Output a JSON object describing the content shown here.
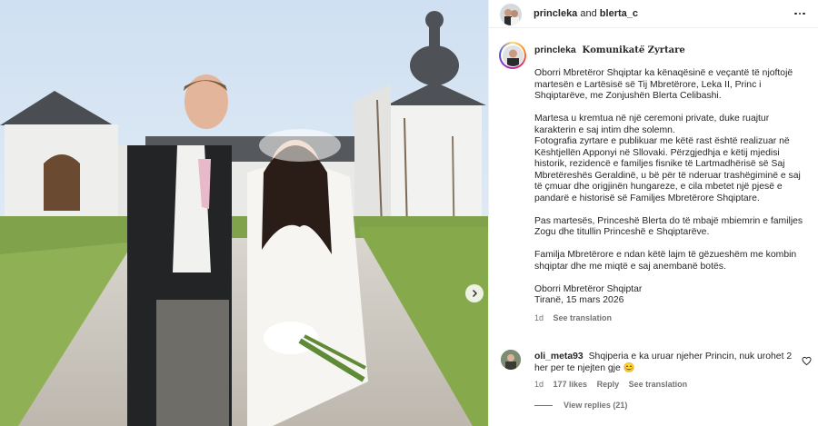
{
  "header": {
    "user1": "princleka",
    "connector": "and",
    "user2": "blerta_c"
  },
  "post": {
    "username": "princleka",
    "title": "𝐊𝐨𝐦𝐮𝐧𝐢𝐤𝐚𝐭𝐞̈ 𝐙𝐲𝐫𝐭𝐚𝐫𝐞",
    "p1": "Oborri Mbretëror Shqiptar ka kënaqësinë e veçantë të njoftojë martesën e Lartësisë së Tij Mbretërore, Leka II, Princ i Shqiptarëve, me Zonjushën Blerta Celibashi.",
    "p2": "Martesa u kremtua në një ceremoni private, duke ruajtur karakterin e saj intim dhe solemn.",
    "p3": "Fotografia zyrtare e publikuar me këtë rast është realizuar në Kështjellën Apponyi në Sllovaki. Përzgjedhja e këtij mjedisi historik, rezidencë e familjes fisnike të Lartmadhërisë së Saj Mbretëreshës Geraldinë, u bë për të nderuar trashëgiminë e saj të çmuar dhe origjinën hungareze, e cila mbetet një pjesë e pandarë e historisë së Familjes Mbretërore Shqiptare.",
    "p4": "Pas martesës, Princeshë Blerta do të mbajë mbiemrin e familjes Zogu dhe titullin Princeshë e Shqiptarëve.",
    "p5": "Familja Mbretërore e ndan këtë lajm të gëzueshëm me kombin shqiptar dhe me miqtë e saj anembanë botës.",
    "sign1": "Oborri Mbretëror Shqiptar",
    "sign2": "Tiranë, 15 mars 2026",
    "time": "1d",
    "see_translation": "See translation"
  },
  "comment": {
    "username": "oli_meta93",
    "text": "Shqiperia e ka uruar njeher Princin, nuk urohet 2 her per te njejten gje 😊",
    "time": "1d",
    "likes": "177 likes",
    "reply": "Reply",
    "see_translation": "See translation",
    "view_replies": "View replies (21)"
  },
  "icons": {
    "more": "more-options-icon",
    "heart": "heart-icon",
    "next": "chevron-right-icon"
  },
  "colors": {
    "text": "#262626",
    "secondary": "#737373",
    "border": "#efefef"
  }
}
